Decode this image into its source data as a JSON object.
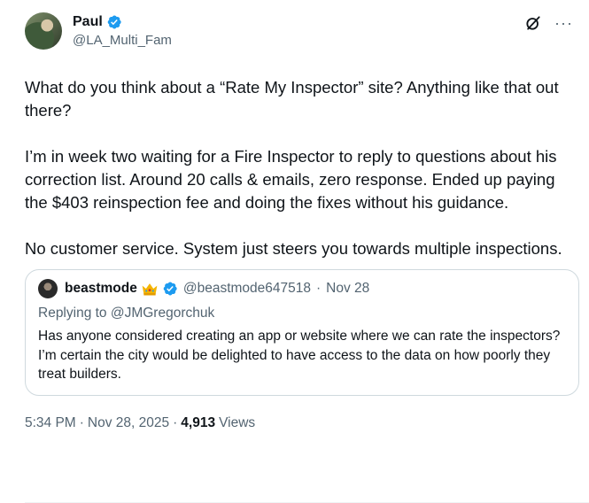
{
  "author": {
    "display_name": "Paul",
    "handle": "@LA_Multi_Fam",
    "verified": true
  },
  "icons": {
    "verified": "verified-badge-icon",
    "grok": "grok-icon",
    "more": "more-icon",
    "crown": "crown-emoji-icon"
  },
  "colors": {
    "verified_blue": "#1d9bf0",
    "secondary_text": "#536471",
    "border": "#cfd9de"
  },
  "tweet": {
    "paragraphs": [
      "What do you think about a “Rate My Inspector” site? Anything like that out there?",
      "I’m in week two waiting for a Fire Inspector to reply to questions about his correction list. Around 20 calls & emails, zero response. Ended up paying the $403 reinspection fee and doing the fixes without his guidance.",
      "No customer service. System just steers you towards multiple inspections."
    ]
  },
  "quote": {
    "display_name": "beastmode",
    "handle": "@beastmode647518",
    "separator": "·",
    "date": "Nov 28",
    "replying_to": "Replying to @JMGregorchuk",
    "text": "Has anyone considered creating an app or website where we can rate the inspectors? I’m certain the city would be delighted to have access to the data on how poorly they treat builders."
  },
  "footer": {
    "time": "5:34 PM",
    "separator": "·",
    "date": "Nov 28, 2025",
    "separator2": "·",
    "views_count": "4,913",
    "views_label": "Views"
  },
  "more_glyph": "···"
}
